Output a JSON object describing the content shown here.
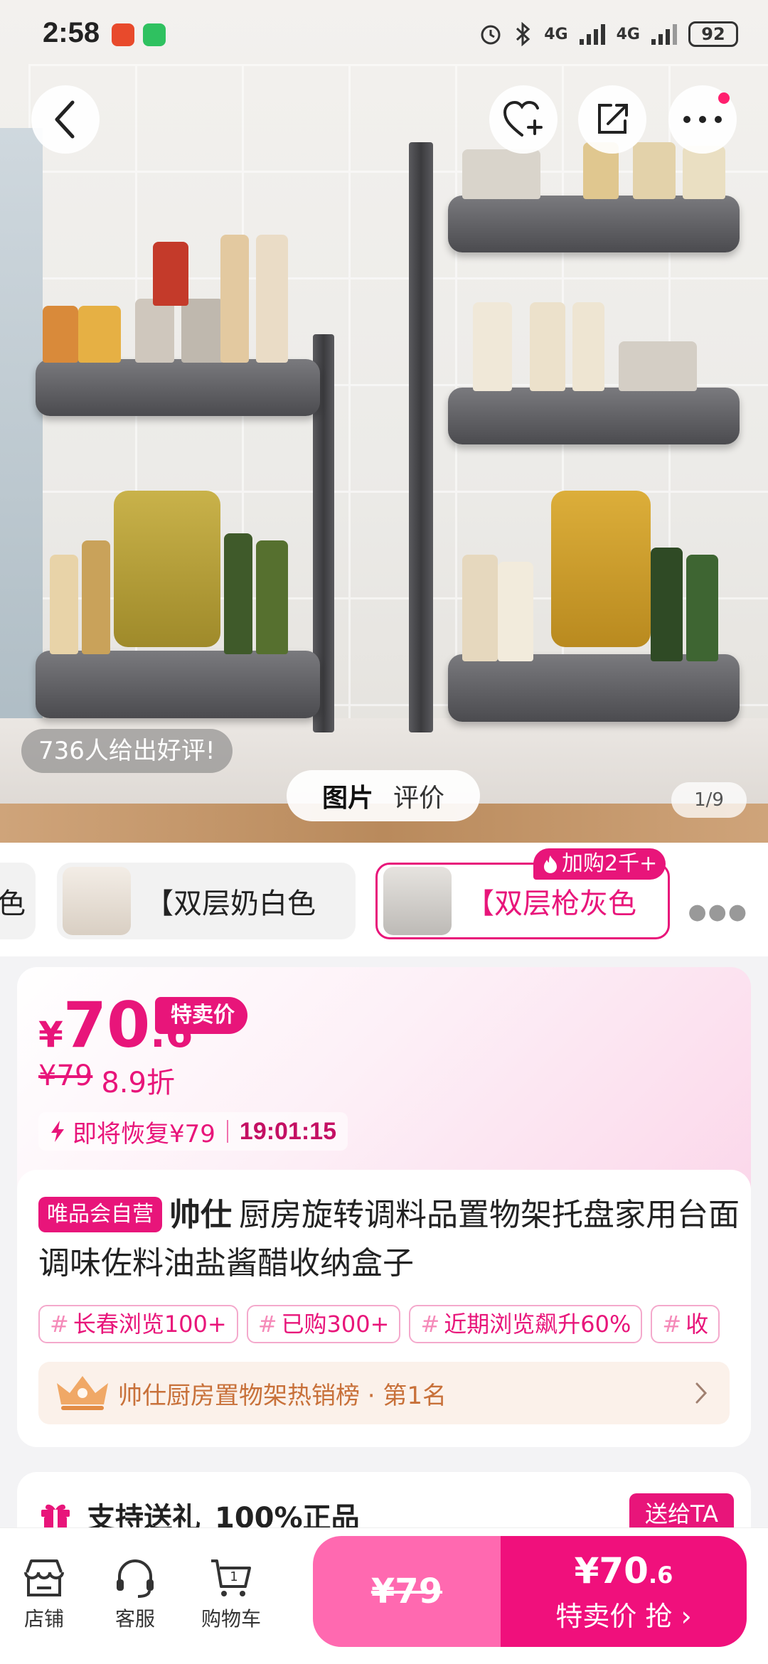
{
  "status_bar": {
    "time": "2:58",
    "battery": "92",
    "network": "4G"
  },
  "hero": {
    "review_text": "736人给出好评!",
    "tabs": [
      "图片",
      "评价"
    ],
    "page_indicator": "1/9"
  },
  "variants": {
    "items": [
      {
        "label": "色"
      },
      {
        "label": "【双层奶白色"
      },
      {
        "label": "【双层枪灰色"
      }
    ],
    "hot_badge": "加购2千+"
  },
  "price": {
    "currency": "¥",
    "integer": "70",
    "decimal": ".6",
    "tag": "特卖价",
    "original": "¥79",
    "discount": "8.9折",
    "restore_text": "即将恢复¥79",
    "countdown": "19:01:15"
  },
  "product": {
    "self_badge": "唯品会自营",
    "brand": "帅仕",
    "title": "厨房旋转调料品置物架托盘家用台面调味佐料油盐酱醋收纳盒子",
    "tags": [
      "长春浏览100+",
      "已购300+",
      "近期浏览飙升60%",
      "收"
    ],
    "rank_text": "帅仕厨房置物架热销榜 · 第1名"
  },
  "gift": {
    "label": "支持送礼",
    "authentic": "100%正品",
    "button": "送给TA"
  },
  "bottom_bar": {
    "store": "店铺",
    "service": "客服",
    "cart": "购物车",
    "cart_count": "1",
    "original_price": "¥79",
    "buy_price": "¥70",
    "buy_price_dec": ".6",
    "buy_label": "特卖价 抢"
  },
  "colors": {
    "accent": "#e8157a",
    "accent_light": "#ff69b0"
  }
}
